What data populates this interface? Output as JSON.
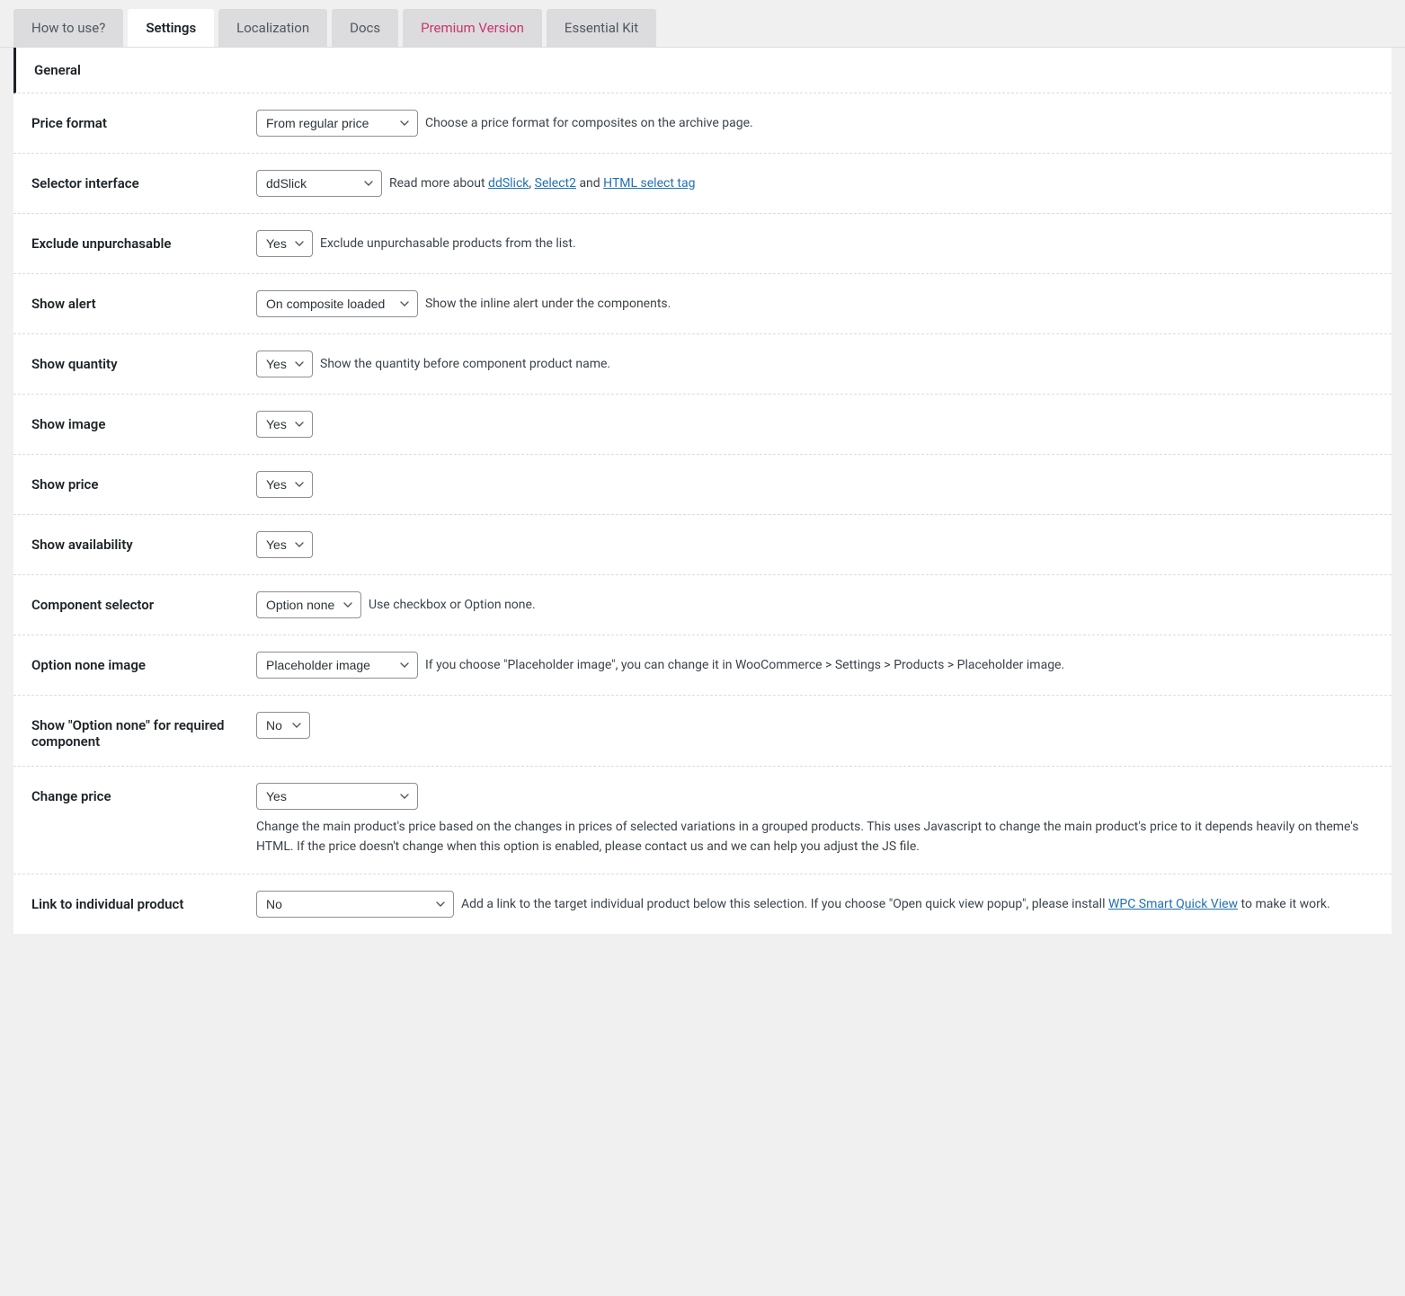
{
  "tabs": {
    "how_to_use": "How to use?",
    "settings": "Settings",
    "localization": "Localization",
    "docs": "Docs",
    "premium": "Premium Version",
    "essential": "Essential Kit"
  },
  "section": {
    "general": "General"
  },
  "rows": {
    "price_format": {
      "label": "Price format",
      "value": "From regular price",
      "desc": "Choose a price format for composites on the archive page."
    },
    "selector_interface": {
      "label": "Selector interface",
      "value": "ddSlick",
      "desc_prefix": "Read more about ",
      "link1": "ddSlick",
      "sep1": ", ",
      "link2": "Select2",
      "sep2": " and ",
      "link3": "HTML select tag"
    },
    "exclude_unpurchasable": {
      "label": "Exclude unpurchasable",
      "value": "Yes",
      "desc": "Exclude unpurchasable products from the list."
    },
    "show_alert": {
      "label": "Show alert",
      "value": "On composite loaded",
      "desc": "Show the inline alert under the components."
    },
    "show_quantity": {
      "label": "Show quantity",
      "value": "Yes",
      "desc": "Show the quantity before component product name."
    },
    "show_image": {
      "label": "Show image",
      "value": "Yes"
    },
    "show_price": {
      "label": "Show price",
      "value": "Yes"
    },
    "show_availability": {
      "label": "Show availability",
      "value": "Yes"
    },
    "component_selector": {
      "label": "Component selector",
      "value": "Option none",
      "desc": "Use checkbox or Option none."
    },
    "option_none_image": {
      "label": "Option none image",
      "value": "Placeholder image",
      "desc": "If you choose \"Placeholder image\", you can change it in WooCommerce > Settings > Products > Placeholder image."
    },
    "show_option_none_required": {
      "label": "Show \"Option none\" for required component",
      "value": "No"
    },
    "change_price": {
      "label": "Change price",
      "value": "Yes",
      "desc": "Change the main product's price based on the changes in prices of selected variations in a grouped products. This uses Javascript to change the main product's price to it depends heavily on theme's HTML. If the price doesn't change when this option is enabled, please contact us and we can help you adjust the JS file."
    },
    "link_individual": {
      "label": "Link to individual product",
      "value": "No",
      "desc_prefix": "Add a link to the target individual product below this selection. If you choose \"Open quick view popup\", please install ",
      "link1": "WPC Smart Quick View",
      "desc_suffix": " to make it work."
    }
  }
}
